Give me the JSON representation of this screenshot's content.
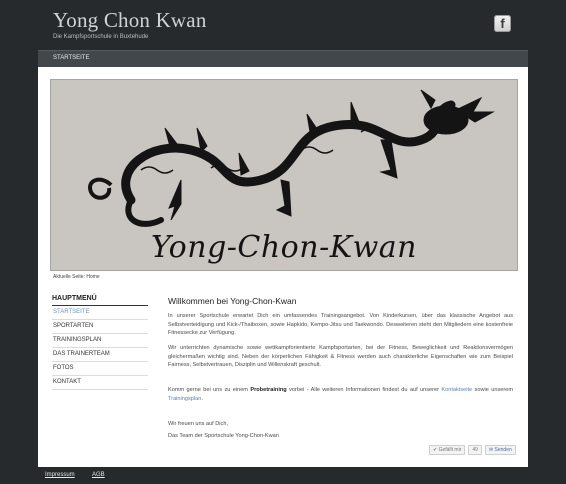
{
  "header": {
    "title": "Yong Chon Kwan",
    "subtitle": "Die Kampfsportschule in Buxtehude",
    "facebook_icon_letter": "f"
  },
  "nav": {
    "items": [
      {
        "label": "STARTSEITE"
      }
    ]
  },
  "banner": {
    "caption": "Yong-Chon-Kwan"
  },
  "breadcrumb": "Aktuelle Seite: Home",
  "sidebar": {
    "title": "HAUPTMENÜ",
    "items": [
      {
        "label": "STARTSEITE",
        "active": true
      },
      {
        "label": "SPORTARTEN"
      },
      {
        "label": "TRAININGSPLAN"
      },
      {
        "label": "DAS TRAINERTEAM"
      },
      {
        "label": "FOTOS"
      },
      {
        "label": "KONTAKT"
      }
    ]
  },
  "main": {
    "heading": "Willkommen bei Yong-Chon-Kwan",
    "paragraph1": "In unserer Sportschule erwartet Dich ein umfassendes Trainingsangebot. Von Kinderkursen, über das klassische Angebot aus Selbstverteidigung und Kick-/Thaiboxen, sowie Hapkido, Kempo-Jitsu und Taekwondo. Desweiteren steht den Mitgliedern eine kostenfreie Fitnessecke zur Verfügung.",
    "paragraph2": "Wir unterrichten dynamische sowie wettkampforientierte Kampfsportarten, bei der Fitness, Beweglichkeit und Reaktionsvermögen gleichermaßen wichtig sind. Neben der körperlichen Fähigkeit & Fitness werden auch charakterliche Eigenschaften wie zum Beispiel Fairness, Selbstvertrauen, Disziplin und Willenskraft geschult.",
    "paragraph3_pre": "Komm gerne bei uns zu einem ",
    "paragraph3_bold": "Probetraining",
    "paragraph3_mid": " vorbei - Alle weiteren Informationen findest du auf unserer ",
    "paragraph3_link1": "Kontaktseite",
    "paragraph3_mid2": " sowie unserem ",
    "paragraph3_link2": "Trainingsplan",
    "paragraph3_end": ".",
    "greeting": "Wir freuen uns auf Dich,",
    "signature": "Das Team der Sportschule Yong-Chon-Kwan"
  },
  "social": {
    "like_label": "Gefällt mir",
    "like_count": "49",
    "send_label": "Senden"
  },
  "footer": {
    "links": [
      "Impressum",
      "AGB"
    ]
  }
}
